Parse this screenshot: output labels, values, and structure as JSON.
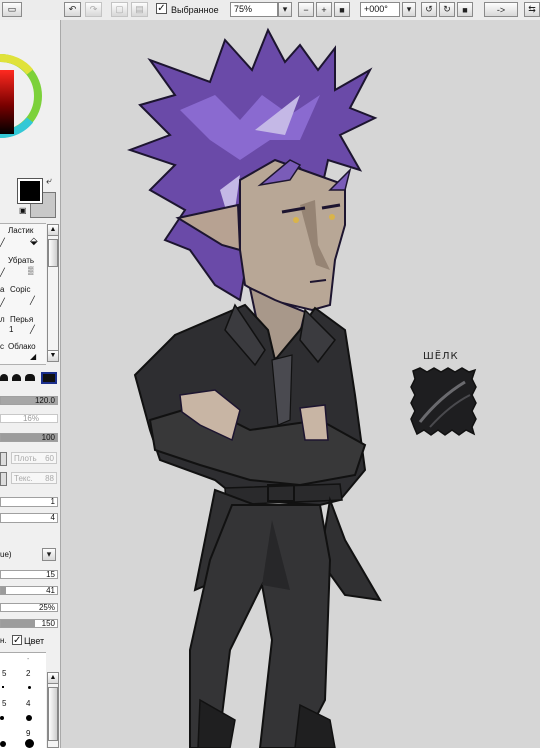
{
  "toolbar": {
    "selection_label": "Выбранное",
    "selection_checked": "✓",
    "zoom_value": "75%",
    "rotation_value": "+000°",
    "arrow_label": "->",
    "minus_glyph": "−",
    "plus_glyph": "+",
    "undo_glyph": "↶",
    "redo_glyph": "↷",
    "dropdown_glyph": "▾"
  },
  "color_panel": {
    "primary_color": "#000000",
    "secondary_color": "#c8c8c8",
    "swap_glyph": "⤶"
  },
  "tools": {
    "items": [
      {
        "label": "Ластик"
      },
      {
        "label": "Убрать"
      },
      {
        "label": "a"
      },
      {
        "label": "Copic"
      },
      {
        "label": "л"
      },
      {
        "label": "Перья"
      },
      {
        "label": "1"
      },
      {
        "label": "с"
      },
      {
        "label": "Облако"
      }
    ],
    "up_glyph": "▲",
    "down_glyph": "▼"
  },
  "brush_settings": {
    "size_value": "120.0",
    "min_size_value": "16%",
    "density_value": "100",
    "blend_label": "Плоть",
    "blend_value": "60",
    "texture_label": "Текс.",
    "texture_value": "88",
    "field_a": "1",
    "field_b": "4",
    "mode_label": "ue)",
    "mode_dropdown": "▾",
    "param1": "15",
    "param2": "41",
    "param3": "25%",
    "param4": "150",
    "check_prefix": "н.",
    "color_checkbox_label": "Цвет",
    "color_checked": "✓",
    "grid": [
      "5",
      "2",
      "5",
      "4",
      "9",
      "-"
    ]
  },
  "canvas": {
    "swatch_label": "ШЁЛК",
    "background": "#d6d6d6"
  }
}
